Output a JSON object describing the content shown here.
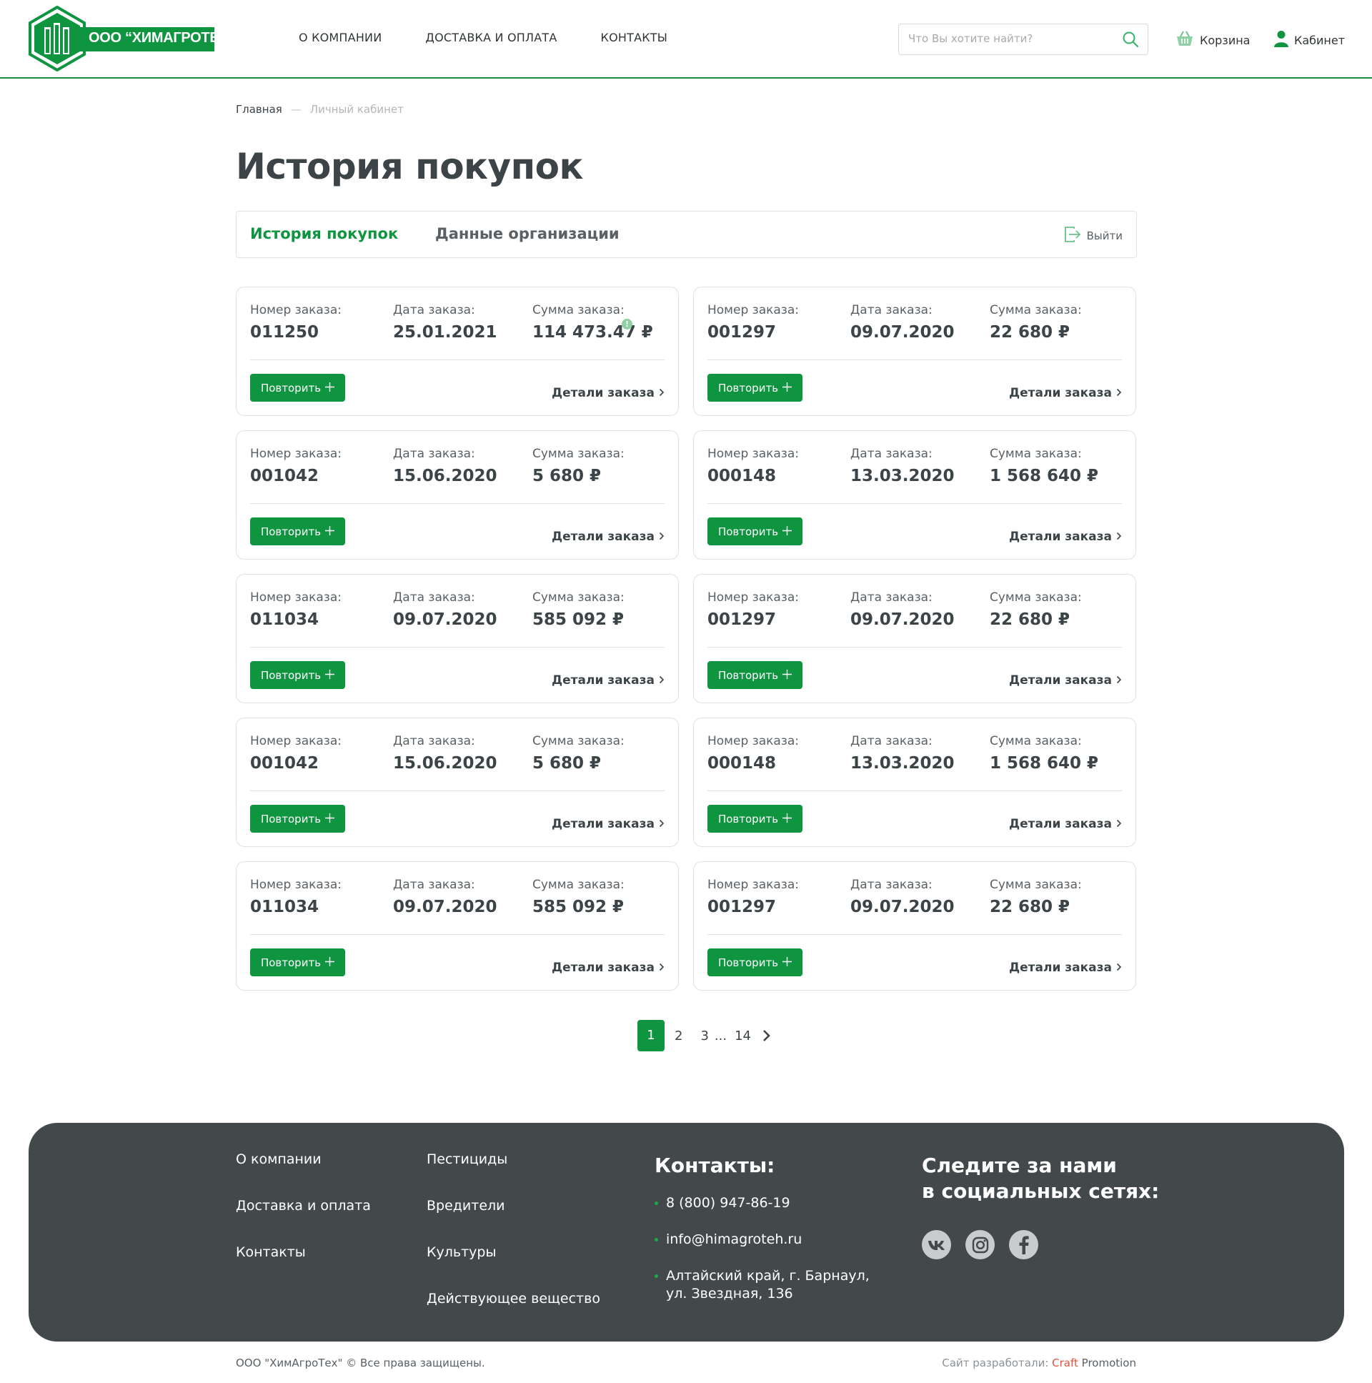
{
  "header": {
    "logo_text": "ООО “ХИМАГРОТЕХ”",
    "nav": [
      "О КОМПАНИИ",
      "ДОСТАВКА И ОПЛАТА",
      "КОНТАКТЫ"
    ],
    "search_placeholder": "Что Вы хотите найти?",
    "cart_label": "Корзина",
    "cabinet_label": "Кабинет"
  },
  "breadcrumb": {
    "home": "Главная",
    "separator": "—",
    "current": "Личный кабинет"
  },
  "page_title": "История покупок",
  "tabs": {
    "active": "История покупок",
    "second": "Данные организации",
    "logout": "Выйти"
  },
  "order_labels": {
    "number": "Номер заказа:",
    "date": "Дата заказа:",
    "sum": "Сумма заказа:",
    "repeat": "Повторить",
    "details": "Детали заказа"
  },
  "orders": [
    {
      "number": "011250",
      "date": "25.01.2021",
      "sum": "114 473.47 ₽",
      "info_badge": "!"
    },
    {
      "number": "001297",
      "date": "09.07.2020",
      "sum": "22 680 ₽"
    },
    {
      "number": "001042",
      "date": "15.06.2020",
      "sum": "5 680 ₽"
    },
    {
      "number": "000148",
      "date": "13.03.2020",
      "sum": "1 568 640 ₽"
    },
    {
      "number": "011034",
      "date": "09.07.2020",
      "sum": "585 092 ₽"
    },
    {
      "number": "001297",
      "date": "09.07.2020",
      "sum": "22 680 ₽"
    },
    {
      "number": "001042",
      "date": "15.06.2020",
      "sum": "5 680 ₽"
    },
    {
      "number": "000148",
      "date": "13.03.2020",
      "sum": "1 568 640 ₽"
    },
    {
      "number": "011034",
      "date": "09.07.2020",
      "sum": "585 092 ₽"
    },
    {
      "number": "001297",
      "date": "09.07.2020",
      "sum": "22 680 ₽"
    }
  ],
  "pagination": {
    "pages": [
      "1",
      "2",
      "3"
    ],
    "ellipsis": "...",
    "last": "14",
    "current": "1"
  },
  "footer": {
    "col1": [
      "О компании",
      "Доставка и оплата",
      "Контакты"
    ],
    "col2": [
      "Пестициды",
      "Вредители",
      "Культуры",
      "Действующее вещество"
    ],
    "contacts_title": "Контакты:",
    "phone": "8 (800) 947-86-19",
    "email": "info@himagroteh.ru",
    "address_line1": "Алтайский край, г. Барнаул,",
    "address_line2": "ул. Звездная, 136",
    "social_title_line1": "Следите за нами",
    "social_title_line2": "в социальных сетях:",
    "socials": [
      "vk-icon",
      "instagram-icon",
      "facebook-icon"
    ]
  },
  "bottom": {
    "copyright": "ООО \"ХимАгроТех\" © Все права защищены.",
    "dev_label": "Сайт разработали:",
    "dev_name_1": "Craft",
    "dev_name_2": "Promotion"
  },
  "colors": {
    "brand_green": "#0f9440",
    "footer_bg": "#43494b",
    "text_dark": "#3d4448"
  }
}
